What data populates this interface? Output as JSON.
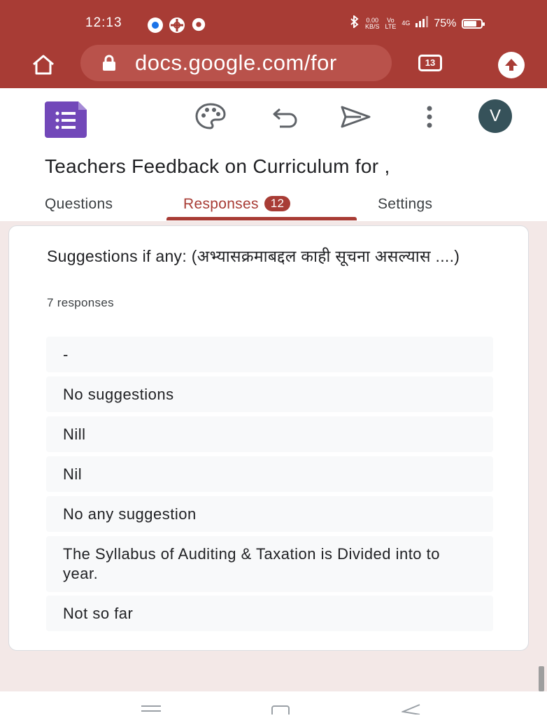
{
  "status_bar": {
    "time": "12:13",
    "net_speed_top": "0.00",
    "net_speed_bottom": "KB/S",
    "vo_top": "Vo",
    "vo_bottom": "LTE",
    "network": "4G",
    "battery": "75%",
    "battery_level": 0.75
  },
  "browser": {
    "url": "docs.google.com/for",
    "tab_count": "13"
  },
  "toolbar": {
    "avatar_letter": "V"
  },
  "form": {
    "title": "Teachers Feedback on Curriculum for ,"
  },
  "tabs": [
    {
      "label": "Questions",
      "active": false
    },
    {
      "label": "Responses",
      "active": true,
      "badge": "12"
    },
    {
      "label": "Settings",
      "active": false
    }
  ],
  "question": {
    "title": "Suggestions if any: (अभ्यासक्रमाबद्दल काही सूचना असल्यास ....)",
    "count": "7 responses",
    "responses": [
      "-",
      "No suggestions",
      "Nill",
      "Nil",
      "No any suggestion",
      "The Syllabus of Auditing & Taxation is Divided into to year.",
      "Not so far"
    ]
  },
  "colors": {
    "brand": "#a83c35",
    "url_bar": "#b9524b",
    "content_bg": "#f3e8e7",
    "forms_purple": "#7248b9"
  }
}
